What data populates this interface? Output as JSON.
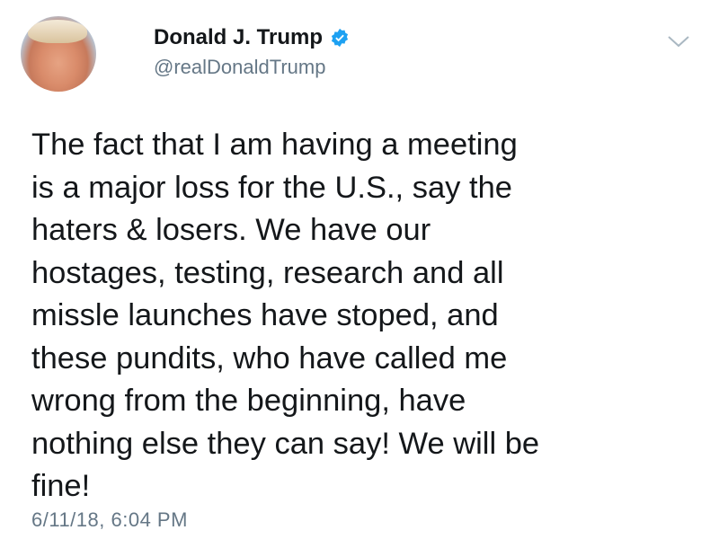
{
  "author": {
    "name": "Donald J. Trump",
    "handle": "@realDonaldTrump",
    "verified": true,
    "verified_color": "#1da1f2"
  },
  "tweet": {
    "lines": [
      "The fact that I am having a meeting",
      "is a major loss for the U.S., say the",
      "haters & losers. We have our",
      "hostages, testing, research and all",
      "missle launches have stoped, and",
      "these pundits, who have called me",
      "wrong from the beginning, have",
      "nothing else they can say! We will be",
      "fine!"
    ],
    "timestamp": "6/11/18, 6:04 PM"
  },
  "icons": {
    "menu": "chevron-down-icon",
    "verified": "verified-badge-icon"
  }
}
